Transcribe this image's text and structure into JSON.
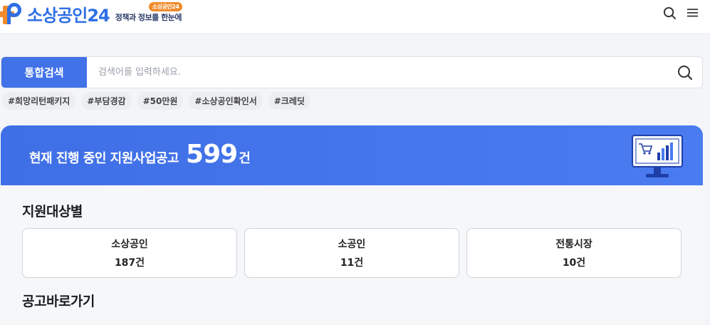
{
  "header": {
    "logo_text": "소상공인24",
    "logo_badge": "소상공인24",
    "logo_subtitle": "정책과 정보를 한눈에",
    "icons": [
      "search-icon",
      "menu-icon"
    ]
  },
  "search": {
    "tab_label": "통합검색",
    "placeholder": "검색어를 입력하세요.",
    "value": ""
  },
  "tags": [
    "#희망리턴패키지",
    "#부담경감",
    "#50만원",
    "#소상공인확인서",
    "#크레딧"
  ],
  "banner": {
    "label": "현재 진행 중인 지원사업공고",
    "count": "599",
    "unit": "건"
  },
  "target_section": {
    "title": "지원대상별",
    "items": [
      {
        "name": "소상공인",
        "count": "187건"
      },
      {
        "name": "소공인",
        "count": "11건"
      },
      {
        "name": "전통시장",
        "count": "10건"
      }
    ]
  },
  "shortcut_section": {
    "title": "공고바로가기"
  },
  "colors": {
    "brand_blue": "#2f6fe4",
    "brand_orange": "#f08a2b",
    "banner_blue": "#4272e8"
  }
}
